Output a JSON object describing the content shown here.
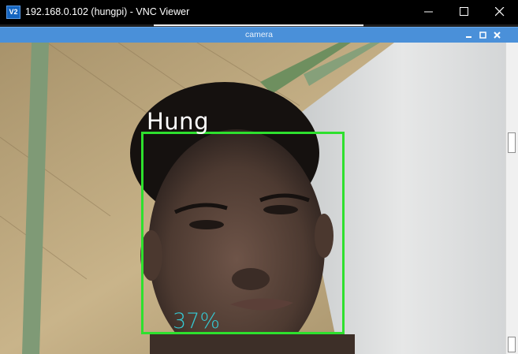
{
  "vnc_window": {
    "logo_text": "V2",
    "title": "192.168.0.102 (hungpi) - VNC Viewer",
    "controls": {
      "minimize_icon": "minimize-icon",
      "maximize_icon": "maximize-icon",
      "close_icon": "close-icon"
    }
  },
  "camera_window": {
    "title": "camera",
    "controls": {
      "minimize_icon": "minimize-icon",
      "maximize_icon": "maximize-icon",
      "close_icon": "close-icon"
    },
    "accent_color": "#4a90d9"
  },
  "detection": {
    "name": "Hung",
    "confidence": "37%",
    "box_color": "#2ee02e",
    "name_color": "#ffffff",
    "confidence_color": "#35c9d3"
  }
}
